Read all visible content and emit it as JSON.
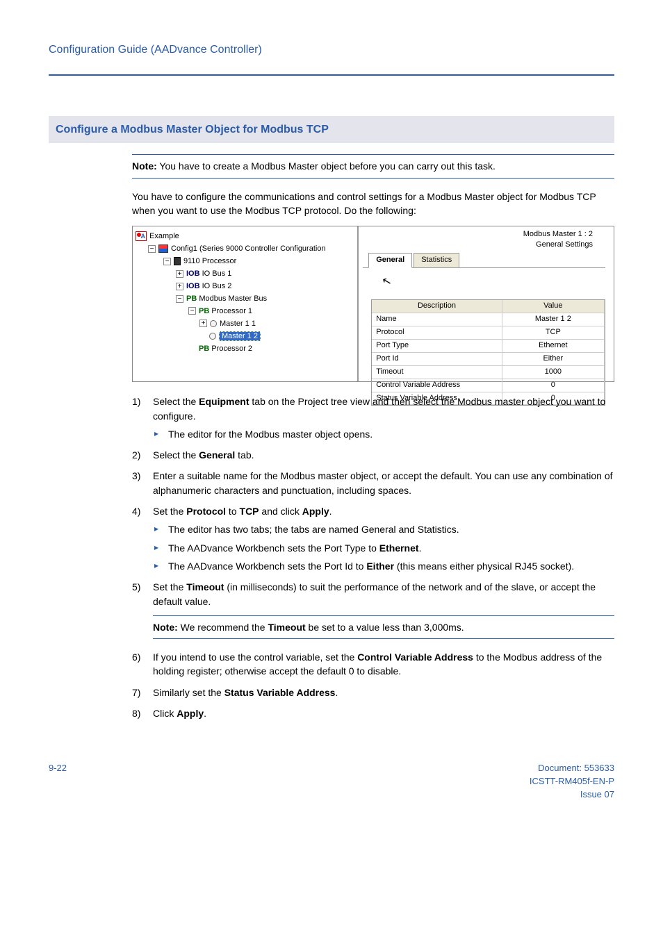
{
  "header": {
    "title": "Configuration Guide (AADvance Controller)"
  },
  "section": {
    "heading": "Configure a Modbus Master Object for Modbus TCP"
  },
  "note1": {
    "label": "Note:",
    "text": " You have to create a Modbus Master object before you can carry out this task."
  },
  "intro": "You have to configure the communications and control settings for a Modbus Master object for Modbus TCP when you want to use the Modbus TCP protocol. Do the following:",
  "tree": {
    "root": "Example",
    "config": "Config1 (Series 9000 Controller Configuration",
    "proc_main": "9110 Processor",
    "iob1": "IO Bus 1",
    "iob2": "IO Bus 2",
    "mmb": "Modbus Master Bus",
    "proc1": "Processor 1",
    "m11": "Master 1 1",
    "m12": "Master 1 2",
    "proc2": "Processor 2",
    "iob_label": "IOB",
    "pb_label": "PB"
  },
  "panel": {
    "title_line1": "Modbus Master 1 : 2",
    "title_line2": "General Settings",
    "tab_general": "General",
    "tab_stats": "Statistics",
    "grid_hdr_desc": "Description",
    "grid_hdr_val": "Value",
    "rows": [
      {
        "d": "Name",
        "v": "Master 1 2"
      },
      {
        "d": "Protocol",
        "v": "TCP"
      },
      {
        "d": "Port Type",
        "v": "Ethernet"
      },
      {
        "d": "Port Id",
        "v": "Either"
      },
      {
        "d": "Timeout",
        "v": "1000"
      },
      {
        "d": "Control Variable Address",
        "v": "0"
      },
      {
        "d": "Status Variable Address",
        "v": "0"
      }
    ]
  },
  "steps": {
    "s1a": "Select the ",
    "s1b": "Equipment",
    "s1c": " tab on the Project tree view and then select the Modbus master object you want to configure.",
    "s1sub": "The editor for the Modbus master object opens.",
    "s2a": "Select the ",
    "s2b": "General",
    "s2c": " tab.",
    "s3": "Enter a suitable name for the Modbus master object, or accept the default. You can use any combination of alphanumeric characters and punctuation, including spaces.",
    "s4a": "Set the ",
    "s4b": "Protocol",
    "s4c": " to ",
    "s4d": "TCP",
    "s4e": " and click ",
    "s4f": "Apply",
    "s4g": ".",
    "s4sub1": "The editor has two tabs; the tabs are named General and Statistics.",
    "s4sub2a": "The AADvance Workbench sets the Port Type to ",
    "s4sub2b": "Ethernet",
    "s4sub2c": ".",
    "s4sub3a": "The AADvance Workbench sets the Port Id to ",
    "s4sub3b": "Either",
    "s4sub3c": " (this means either physical RJ45 socket).",
    "s5a": "Set the ",
    "s5b": "Timeout",
    "s5c": " (in milliseconds) to suit the performance of the network and of the slave, or accept the default value.",
    "s6a": "If you intend to use the control variable, set the ",
    "s6b": "Control Variable Address",
    "s6c": " to the Modbus address of the holding register; otherwise accept the default 0 to disable.",
    "s7a": "Similarly set the ",
    "s7b": "Status Variable Address",
    "s7c": ".",
    "s8a": "Click ",
    "s8b": "Apply",
    "s8c": "."
  },
  "note2": {
    "label": "Note:",
    "a": " We recommend the ",
    "b": "Timeout",
    "c": " be set to a value less than 3,000ms."
  },
  "footer": {
    "page": "9-22",
    "doc": "Document: 553633",
    "code": "ICSTT-RM405f-EN-P",
    "issue": "Issue 07"
  }
}
